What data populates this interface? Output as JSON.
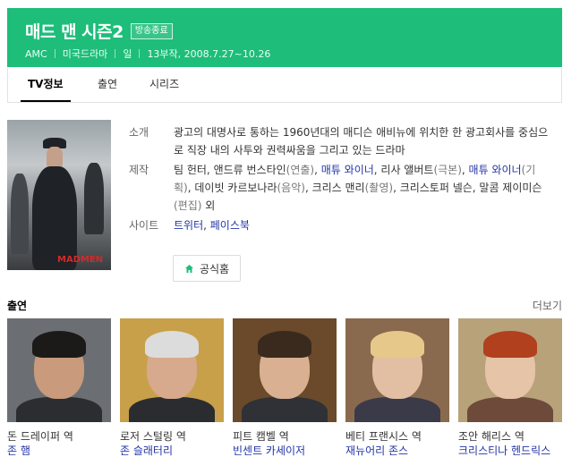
{
  "header": {
    "title": "매드 맨 시즌2",
    "status_badge": "방송종료",
    "meta": [
      "AMC",
      "미국드라마",
      "일",
      "13부작, 2008.7.27~10.26"
    ],
    "bg_color": "#1ebd7a"
  },
  "tabs": [
    {
      "label": "TV정보",
      "active": true
    },
    {
      "label": "출연",
      "active": false
    },
    {
      "label": "시리즈",
      "active": false
    }
  ],
  "poster": {
    "logo_text": "MADMEN"
  },
  "info": {
    "summary_label": "소개",
    "summary": "광고의 대명사로 통하는 1960년대의 매디슨 애비뉴에 위치한 한 광고회사를 중심으로 직장 내의 사투와 권력싸움을 그리고 있는 드라마",
    "credits_label": "제작",
    "credits": [
      {
        "text": "팀 헌터, 앤드류 번스타인",
        "link": false
      },
      {
        "text": "(연출)",
        "link": false,
        "gray": true
      },
      {
        "text": ", ",
        "link": false
      },
      {
        "text": "매튜 와이너",
        "link": true
      },
      {
        "text": ", 리사 앨버트",
        "link": false
      },
      {
        "text": "(극본)",
        "link": false,
        "gray": true
      },
      {
        "text": ", ",
        "link": false
      },
      {
        "text": "매튜 와이너",
        "link": true
      },
      {
        "text": "(기획)",
        "link": false,
        "gray": true
      },
      {
        "text": ", 데이빗 카르보나라",
        "link": false
      },
      {
        "text": "(음악)",
        "link": false,
        "gray": true
      },
      {
        "text": ", 크리스 맨리",
        "link": false
      },
      {
        "text": "(촬영)",
        "link": false,
        "gray": true
      },
      {
        "text": ", 크리스토퍼 넬슨, 말콤 제이미슨",
        "link": false
      },
      {
        "text": "(편집)",
        "link": false,
        "gray": true
      },
      {
        "text": " 외",
        "link": false
      }
    ],
    "site_label": "사이트",
    "sites": [
      "트위터",
      "페이스북"
    ],
    "site_separator": ", ",
    "home_button": "공식홈"
  },
  "cast_section": {
    "title": "출연",
    "more": "더보기",
    "members": [
      {
        "role": "돈 드레이퍼 역",
        "actor": "존 햄",
        "bg": "#6b6f73",
        "skin": "#c99a7c",
        "hair": "#1c1a18",
        "suit": "#2b2d31"
      },
      {
        "role": "로저 스털링 역",
        "actor": "존 슬래터리",
        "bg": "#c8a04a",
        "skin": "#d7a98d",
        "hair": "#dcdcdc",
        "suit": "#2a2c30"
      },
      {
        "role": "피트 캠벨 역",
        "actor": "빈센트 카세이저",
        "bg": "#6a4a2a",
        "skin": "#d9b092",
        "hair": "#3a2a1e",
        "suit": "#2f3136"
      },
      {
        "role": "베티 프랜시스 역",
        "actor": "재뉴어리 존스",
        "bg": "#8a6a4e",
        "skin": "#e2bfa2",
        "hair": "#e6c98a",
        "suit": "#3b3a48"
      },
      {
        "role": "조안 해리스 역",
        "actor": "크리스티나 헨드릭스",
        "bg": "#b7a27a",
        "skin": "#e6c4a8",
        "hair": "#b0401e",
        "suit": "#6d4a3a"
      }
    ]
  }
}
